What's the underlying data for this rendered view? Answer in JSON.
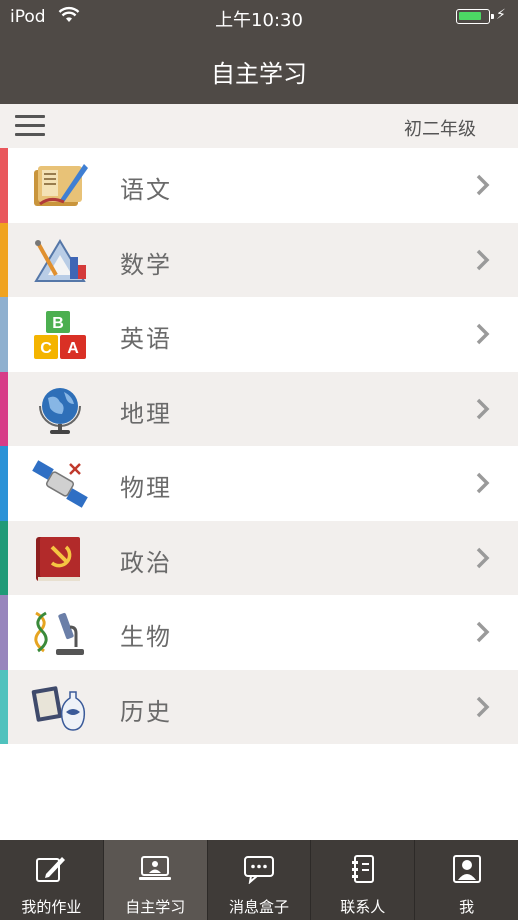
{
  "status_bar": {
    "carrier": "iPod",
    "time": "上午10:30"
  },
  "header": {
    "title": "自主学习"
  },
  "subbar": {
    "grade": "初二年级"
  },
  "subjects": [
    {
      "label": "语文",
      "color": "#e9575c"
    },
    {
      "label": "数学",
      "color": "#f0a31f"
    },
    {
      "label": "英语",
      "color": "#8fb0cf"
    },
    {
      "label": "地理",
      "color": "#d73c88"
    },
    {
      "label": "物理",
      "color": "#2a92d7"
    },
    {
      "label": "政治",
      "color": "#1f9a77"
    },
    {
      "label": "生物",
      "color": "#9886bd"
    },
    {
      "label": "历史",
      "color": "#4fc2bd"
    }
  ],
  "tabs": [
    {
      "label": "我的作业",
      "icon": "pencil-icon"
    },
    {
      "label": "自主学习",
      "icon": "monitor-icon",
      "active": true
    },
    {
      "label": "消息盒子",
      "icon": "message-icon"
    },
    {
      "label": "联系人",
      "icon": "contacts-icon"
    },
    {
      "label": "我",
      "icon": "person-icon"
    }
  ]
}
